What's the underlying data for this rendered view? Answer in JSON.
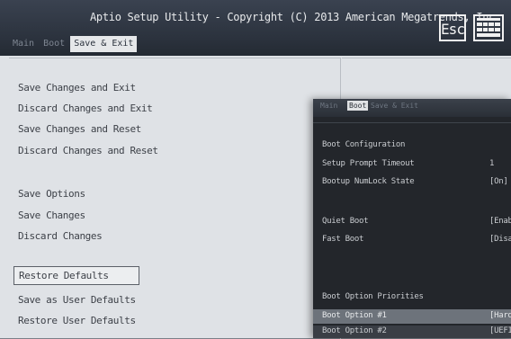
{
  "window": {
    "title": "Aptio Setup Utility - Copyright (C) 2013 American Megatrends, Inc."
  },
  "tabs": [
    {
      "label": "Main"
    },
    {
      "label": "Boot"
    },
    {
      "label": "Save & Exit"
    }
  ],
  "buttons": {
    "esc_label": "Esc"
  },
  "menu": {
    "items": [
      {
        "label": "Save Changes and Exit"
      },
      {
        "label": "Discard Changes and Exit"
      },
      {
        "label": "Save Changes and Reset"
      },
      {
        "label": "Discard Changes and Reset"
      },
      {
        "label": "Save Options"
      },
      {
        "label": "Save Changes"
      },
      {
        "label": "Discard Changes"
      },
      {
        "label": "Restore Defaults"
      },
      {
        "label": "Save as User Defaults"
      },
      {
        "label": "Restore User Defaults"
      }
    ]
  },
  "overlay": {
    "tabs": [
      {
        "label": "Main"
      },
      {
        "label": "Boot"
      },
      {
        "label": "Save & Exit"
      }
    ],
    "rows": [
      {
        "label": "Boot Configuration",
        "value": ""
      },
      {
        "label": "Setup Prompt Timeout",
        "value": "1"
      },
      {
        "label": "Bootup NumLock State",
        "value": "[On]"
      },
      {
        "label": "Quiet Boot",
        "value": "[Enab"
      },
      {
        "label": "Fast Boot",
        "value": "[Disa"
      },
      {
        "label": "Boot Option Priorities",
        "value": ""
      },
      {
        "label": "Boot Option #1",
        "value": "[Hard"
      },
      {
        "label": "Boot Option #2",
        "value": "[UEFI"
      }
    ]
  },
  "colors": {
    "title_bg": "#2b323d",
    "panel_bg": "#dfe2e6",
    "overlay_bg": "#23262b"
  }
}
